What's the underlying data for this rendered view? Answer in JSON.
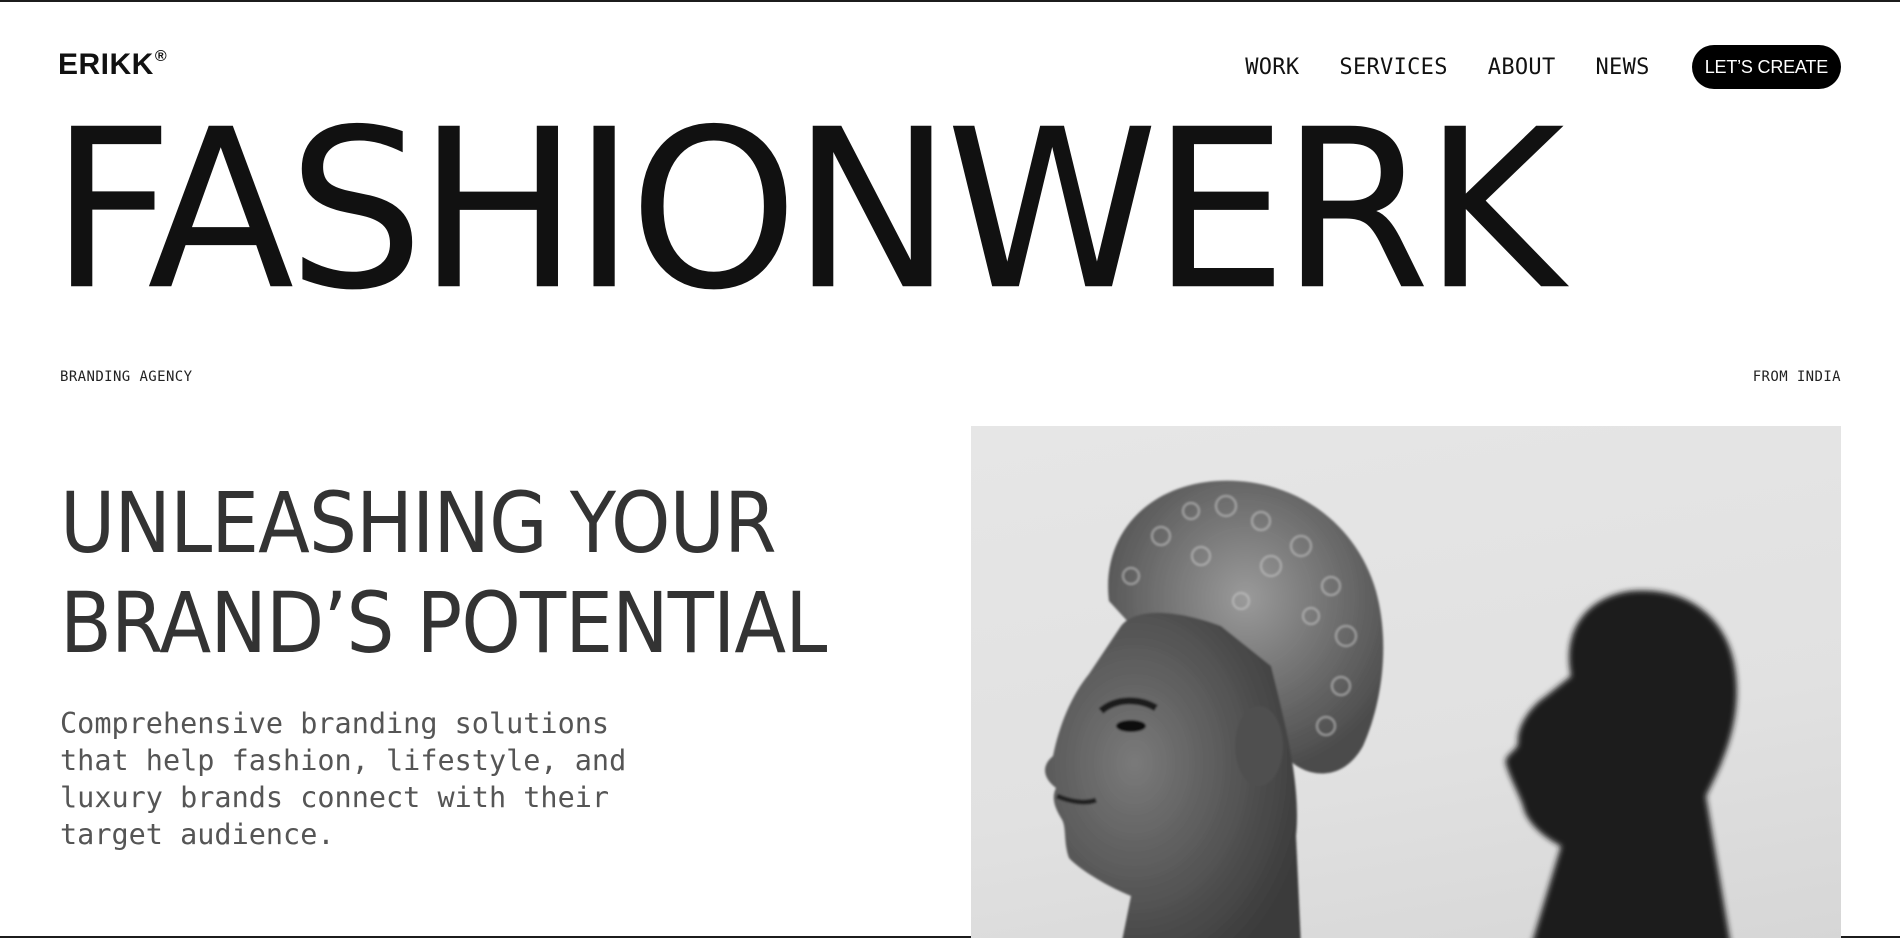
{
  "brand": {
    "name": "ERIKK",
    "mark": "®"
  },
  "nav": {
    "links": [
      "WORK",
      "SERVICES",
      "ABOUT",
      "NEWS"
    ],
    "cta": "LET’S CREATE"
  },
  "hero": {
    "title": "FASHIONWERK",
    "tag_left": "BRANDING AGENCY",
    "tag_right": "FROM INDIA"
  },
  "main": {
    "headline_lines": [
      "UNLEASHING YOUR",
      "BRAND’S POTENTIAL"
    ],
    "intro": "Comprehensive branding solutions that help fashion, lifestyle, and luxury brands connect with their target audience."
  },
  "image": {
    "subject": "black-and-white photo of two people in profile"
  },
  "colors": {
    "text": "#111111",
    "cta_bg": "#000000",
    "cta_text": "#ffffff",
    "muted_text": "#555555"
  }
}
